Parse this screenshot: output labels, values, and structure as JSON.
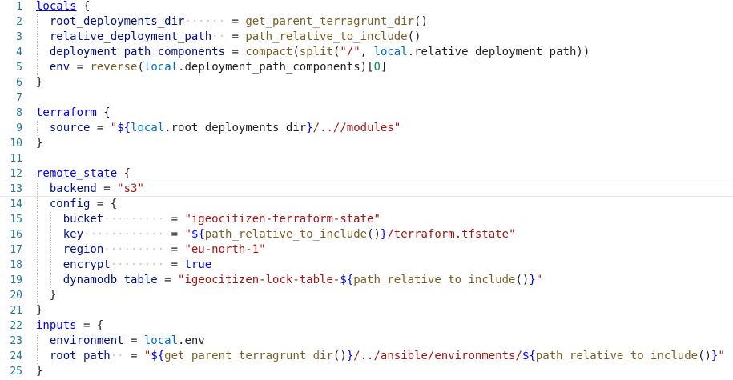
{
  "editor": {
    "language": "hcl",
    "current_line": 13,
    "colors": {
      "keyword": "#0000ff",
      "attribute": "#001080",
      "string": "#a31515",
      "function": "#795e26",
      "variable": "#0070c1",
      "number": "#098658",
      "line_number": "#237893"
    },
    "lines": [
      {
        "n": "1",
        "indent": 0,
        "tokens": [
          {
            "t": "kwu",
            "v": "locals"
          },
          {
            "t": "op",
            "v": " {"
          }
        ]
      },
      {
        "n": "2",
        "indent": 1,
        "tokens": [
          {
            "t": "attr",
            "v": "root_deployments_dir"
          },
          {
            "t": "pad",
            "v": "······"
          },
          {
            "t": "op",
            "v": " = "
          },
          {
            "t": "fn",
            "v": "get_parent_terragrunt_dir"
          },
          {
            "t": "op",
            "v": "()"
          }
        ]
      },
      {
        "n": "3",
        "indent": 1,
        "tokens": [
          {
            "t": "attr",
            "v": "relative_deployment_path"
          },
          {
            "t": "pad",
            "v": "··"
          },
          {
            "t": "op",
            "v": " = "
          },
          {
            "t": "fn",
            "v": "path_relative_to_include"
          },
          {
            "t": "op",
            "v": "()"
          }
        ]
      },
      {
        "n": "4",
        "indent": 1,
        "tokens": [
          {
            "t": "attr",
            "v": "deployment_path_components"
          },
          {
            "t": "op",
            "v": " = "
          },
          {
            "t": "fn",
            "v": "compact"
          },
          {
            "t": "op",
            "v": "("
          },
          {
            "t": "fn",
            "v": "split"
          },
          {
            "t": "op",
            "v": "("
          },
          {
            "t": "str",
            "v": "\"/\""
          },
          {
            "t": "op",
            "v": ", "
          },
          {
            "t": "var",
            "v": "local"
          },
          {
            "t": "op",
            "v": ".relative_deployment_path))"
          }
        ]
      },
      {
        "n": "5",
        "indent": 1,
        "tokens": [
          {
            "t": "attr",
            "v": "env"
          },
          {
            "t": "op",
            "v": " = "
          },
          {
            "t": "fn",
            "v": "reverse"
          },
          {
            "t": "op",
            "v": "("
          },
          {
            "t": "var",
            "v": "local"
          },
          {
            "t": "op",
            "v": ".deployment_path_components)["
          },
          {
            "t": "num",
            "v": "0"
          },
          {
            "t": "op",
            "v": "]"
          }
        ]
      },
      {
        "n": "6",
        "indent": 0,
        "tokens": [
          {
            "t": "op",
            "v": "}"
          }
        ]
      },
      {
        "n": "7",
        "indent": 0,
        "tokens": []
      },
      {
        "n": "8",
        "indent": 0,
        "tokens": [
          {
            "t": "kw",
            "v": "terraform"
          },
          {
            "t": "op",
            "v": " {"
          }
        ]
      },
      {
        "n": "9",
        "indent": 1,
        "tokens": [
          {
            "t": "attr",
            "v": "source"
          },
          {
            "t": "op",
            "v": " = "
          },
          {
            "t": "str",
            "v": "\""
          },
          {
            "t": "interp",
            "v": "${"
          },
          {
            "t": "var",
            "v": "local"
          },
          {
            "t": "op",
            "v": ".root_deployments_dir"
          },
          {
            "t": "interp",
            "v": "}"
          },
          {
            "t": "str",
            "v": "/..//modules\""
          }
        ]
      },
      {
        "n": "10",
        "indent": 0,
        "tokens": [
          {
            "t": "op",
            "v": "}"
          }
        ]
      },
      {
        "n": "11",
        "indent": 0,
        "tokens": []
      },
      {
        "n": "12",
        "indent": 0,
        "tokens": [
          {
            "t": "kwu",
            "v": "remote_state"
          },
          {
            "t": "op",
            "v": " {"
          }
        ]
      },
      {
        "n": "13",
        "indent": 1,
        "tokens": [
          {
            "t": "attr",
            "v": "backend"
          },
          {
            "t": "op",
            "v": " = "
          },
          {
            "t": "str",
            "v": "\"s3\""
          }
        ]
      },
      {
        "n": "14",
        "indent": 1,
        "tokens": [
          {
            "t": "attr",
            "v": "config"
          },
          {
            "t": "op",
            "v": " = {"
          }
        ]
      },
      {
        "n": "15",
        "indent": 2,
        "tokens": [
          {
            "t": "attr",
            "v": "bucket"
          },
          {
            "t": "pad",
            "v": "·········"
          },
          {
            "t": "op",
            "v": " = "
          },
          {
            "t": "str",
            "v": "\"igeocitizen-terraform-state\""
          }
        ]
      },
      {
        "n": "16",
        "indent": 2,
        "tokens": [
          {
            "t": "attr",
            "v": "key"
          },
          {
            "t": "pad",
            "v": "············"
          },
          {
            "t": "op",
            "v": " = "
          },
          {
            "t": "str",
            "v": "\""
          },
          {
            "t": "interp",
            "v": "${"
          },
          {
            "t": "fn",
            "v": "path_relative_to_include"
          },
          {
            "t": "op",
            "v": "()"
          },
          {
            "t": "interp",
            "v": "}"
          },
          {
            "t": "str",
            "v": "/terraform.tfstate\""
          }
        ]
      },
      {
        "n": "17",
        "indent": 2,
        "tokens": [
          {
            "t": "attr",
            "v": "region"
          },
          {
            "t": "pad",
            "v": "·········"
          },
          {
            "t": "op",
            "v": " = "
          },
          {
            "t": "str",
            "v": "\"eu-north-1\""
          }
        ]
      },
      {
        "n": "18",
        "indent": 2,
        "tokens": [
          {
            "t": "attr",
            "v": "encrypt"
          },
          {
            "t": "pad",
            "v": "········"
          },
          {
            "t": "op",
            "v": " = "
          },
          {
            "t": "bool",
            "v": "true"
          }
        ]
      },
      {
        "n": "19",
        "indent": 2,
        "tokens": [
          {
            "t": "attr",
            "v": "dynamodb_table"
          },
          {
            "t": "op",
            "v": " = "
          },
          {
            "t": "str",
            "v": "\"igeocitizen-lock-table-"
          },
          {
            "t": "interp",
            "v": "${"
          },
          {
            "t": "fn",
            "v": "path_relative_to_include"
          },
          {
            "t": "op",
            "v": "()"
          },
          {
            "t": "interp",
            "v": "}"
          },
          {
            "t": "str",
            "v": "\""
          }
        ]
      },
      {
        "n": "20",
        "indent": 1,
        "tokens": [
          {
            "t": "op",
            "v": "}"
          }
        ]
      },
      {
        "n": "21",
        "indent": 0,
        "tokens": [
          {
            "t": "op",
            "v": "}"
          }
        ]
      },
      {
        "n": "22",
        "indent": 0,
        "tokens": [
          {
            "t": "kw",
            "v": "inputs"
          },
          {
            "t": "op",
            "v": " = {"
          }
        ]
      },
      {
        "n": "23",
        "indent": 1,
        "tokens": [
          {
            "t": "attr",
            "v": "environment"
          },
          {
            "t": "op",
            "v": " = "
          },
          {
            "t": "var",
            "v": "local"
          },
          {
            "t": "op",
            "v": ".env"
          }
        ]
      },
      {
        "n": "24",
        "indent": 1,
        "tokens": [
          {
            "t": "attr",
            "v": "root_path"
          },
          {
            "t": "pad",
            "v": "··"
          },
          {
            "t": "op",
            "v": " = "
          },
          {
            "t": "str",
            "v": "\""
          },
          {
            "t": "interp",
            "v": "${"
          },
          {
            "t": "fn",
            "v": "get_parent_terragrunt_dir"
          },
          {
            "t": "op",
            "v": "()"
          },
          {
            "t": "interp",
            "v": "}"
          },
          {
            "t": "str",
            "v": "/../ansible/environments/"
          },
          {
            "t": "interp",
            "v": "${"
          },
          {
            "t": "fn",
            "v": "path_relative_to_include"
          },
          {
            "t": "op",
            "v": "()"
          },
          {
            "t": "interp",
            "v": "}"
          },
          {
            "t": "str",
            "v": "\""
          }
        ]
      },
      {
        "n": "25",
        "indent": 0,
        "tokens": [
          {
            "t": "op",
            "v": "}"
          }
        ]
      }
    ]
  }
}
